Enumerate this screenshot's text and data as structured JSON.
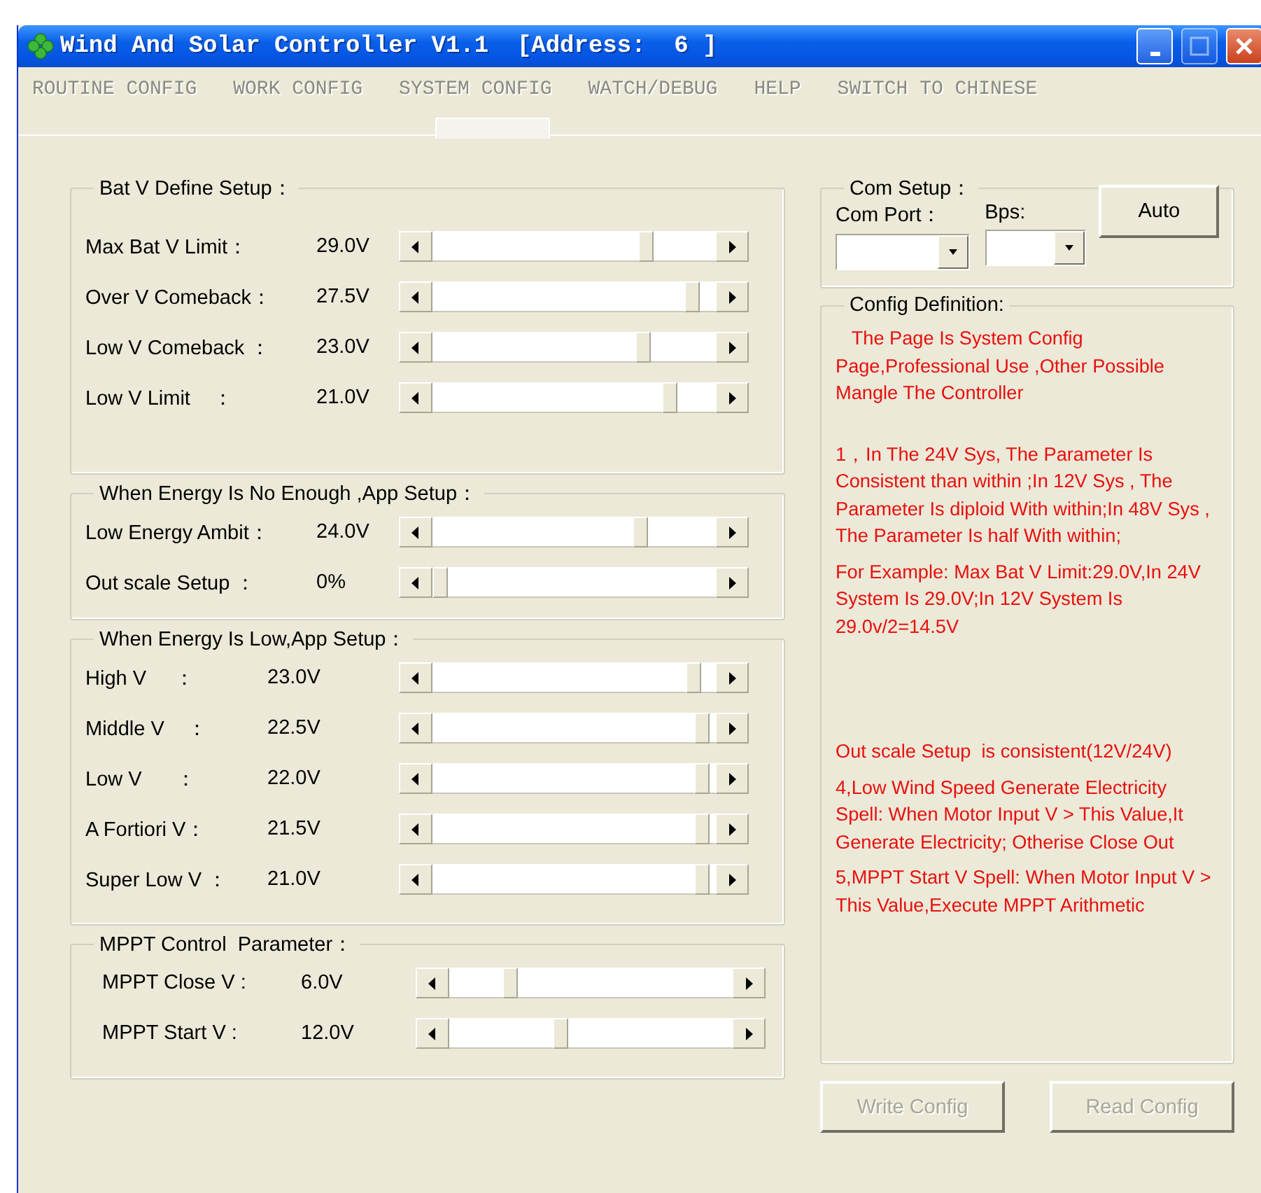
{
  "window": {
    "title": "Wind And Solar Controller V1.1  [Address:  6 ]"
  },
  "menu": [
    {
      "label": "ROUTINE CONFIG"
    },
    {
      "label": "WORK CONFIG"
    },
    {
      "label": "SYSTEM CONFIG"
    },
    {
      "label": "WATCH/DEBUG"
    },
    {
      "label": "HELP"
    },
    {
      "label": "SWITCH TO CHINESE"
    }
  ],
  "groups": [
    {
      "title": "Bat V Define Setup：",
      "rows": [
        {
          "label": "Max Bat V Limit：",
          "reading": "29.0V",
          "level": 0.77
        },
        {
          "label": "Over V Comeback：",
          "reading": "27.5V",
          "level": 0.94
        },
        {
          "label": "Low V Comeback ：",
          "reading": "23.0V",
          "level": 0.76
        },
        {
          "label": "Low V Limit    ：",
          "reading": "21.0V",
          "level": 0.86
        }
      ]
    },
    {
      "title": "When Energy Is No Enough ,App Setup：",
      "rows": [
        {
          "label": "Low Energy Ambit：",
          "reading": "24.0V",
          "level": 0.75
        },
        {
          "label": "Out scale Setup ：",
          "reading": "0%",
          "level": 0
        }
      ]
    },
    {
      "title": "When Energy Is Low,App Setup：",
      "rows": [
        {
          "label": "High V     ：",
          "reading": "23.0V",
          "level": 0.95
        },
        {
          "label": "Middle V    ：",
          "reading": "22.5V",
          "level": 0.98
        },
        {
          "label": "Low V      ：",
          "reading": "22.0V",
          "level": 0.98
        },
        {
          "label": "A Fortiori V：",
          "reading": "21.5V",
          "level": 0.98
        },
        {
          "label": "Super Low V ：",
          "reading": "21.0V",
          "level": 0.98
        }
      ]
    },
    {
      "title": "MPPT Control  Parameter：",
      "rows": [
        {
          "label": "MPPT Close V :",
          "reading": "6.0V",
          "level": 0.2
        },
        {
          "label": "MPPT Start V :",
          "reading": "12.0V",
          "level": 0.39
        }
      ]
    }
  ],
  "com_setup": {
    "title": "Com Setup：",
    "port_label": "Com Port：",
    "bps_label": "Bps:",
    "auto_button": "Auto"
  },
  "config_definition": {
    "title": "Config Definition:",
    "paragraphs": [
      "   The Page Is System Config Page,Professional Use ,Other Possible Mangle The Controller",
      "1，In The 24V Sys, The Parameter Is Consistent than within ;In 12V Sys , The Parameter Is diploid With within;In 48V Sys , The Parameter Is half With within;",
      "For Example: Max Bat V Limit:29.0V,In 24V System Is 29.0V;In 12V System Is 29.0v/2=14.5V",
      "Out scale Setup  is consistent(12V/24V)",
      "4,Low Wind Speed Generate Electricity Spell: When Motor Input V > This Value,It Generate Electricity; Otherise Close Out",
      "5,MPPT Start V Spell: When Motor Input V > This Value,Execute MPPT Arithmetic"
    ]
  },
  "buttons": [
    {
      "label": "Write Config",
      "disabled": true
    },
    {
      "label": "Read Config",
      "disabled": true
    }
  ]
}
